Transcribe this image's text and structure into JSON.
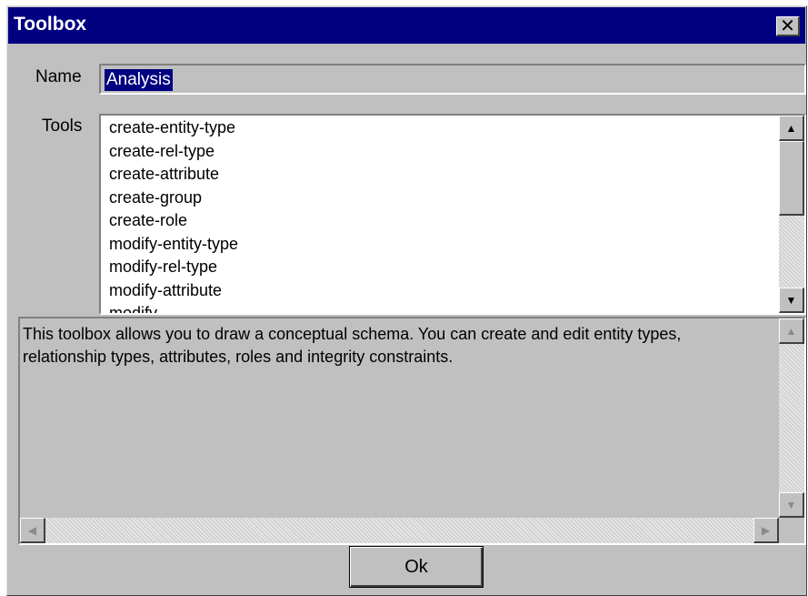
{
  "window": {
    "title": "Toolbox",
    "close_glyph": "✕"
  },
  "name": {
    "label": "Name",
    "value": "Analysis"
  },
  "tools": {
    "label": "Tools",
    "items": [
      "create-entity-type",
      "create-rel-type",
      "create-attribute",
      "create-group",
      "create-role",
      "modify-entity-type",
      "modify-rel-type",
      "modify-attribute",
      "modify-..."
    ]
  },
  "description": {
    "text": "This toolbox allows you to draw a conceptual schema. You can create and edit entity types, relationship types, attributes, roles and integrity constraints."
  },
  "buttons": {
    "ok_label": "Ok"
  },
  "scroll_glyphs": {
    "up": "▲",
    "down": "▼",
    "left": "◀",
    "right": "▶"
  },
  "colors": {
    "titlebar": "#000080",
    "face": "#c0c0c0",
    "selection": "#000080"
  }
}
